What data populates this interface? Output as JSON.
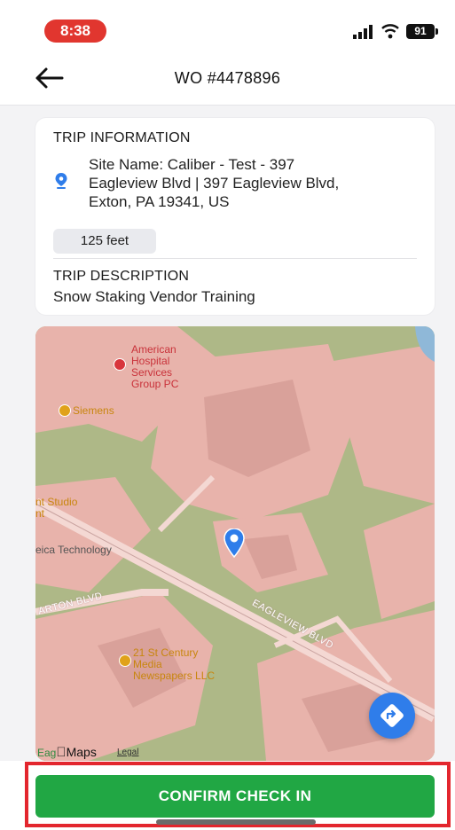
{
  "status_bar": {
    "time": "8:38",
    "battery": "91",
    "icons": [
      "signal-icon",
      "wifi-icon",
      "battery-icon"
    ]
  },
  "header": {
    "title": "WO #4478896",
    "back_icon": "arrow-left-icon"
  },
  "trip": {
    "heading": "TRIP INFORMATION",
    "site_lines": [
      "Site Name: Caliber - Test - 397",
      "Eagleview Blvd | 397 Eagleview Blvd,",
      "Exton, PA 19341, US"
    ],
    "distance": "125 feet",
    "description_heading": "TRIP DESCRIPTION",
    "description": "Snow Staking Vendor Training"
  },
  "map": {
    "pois": {
      "hospital": [
        "American",
        "Hospital",
        "Services",
        "Group PC"
      ],
      "siemens": "Siemens",
      "studio": [
        "nt Studio",
        "nt"
      ],
      "leica": "eica Technology",
      "century": [
        "21 St Century",
        "Media",
        "Newspapers LLC"
      ]
    },
    "streets": {
      "eagleview": "EAGLEVIEW BLVD",
      "larton": "ARTON BLVD"
    },
    "attribution": {
      "logo": "Maps",
      "prefix": "Eag",
      "legal": "Legal"
    },
    "colors": {
      "land": "#aeb887",
      "buildings": "#e8b3ab",
      "pin": "#2f7dea"
    }
  },
  "actions": {
    "confirm_label": "CONFIRM CHECK IN",
    "confirm_color": "#21a744"
  }
}
